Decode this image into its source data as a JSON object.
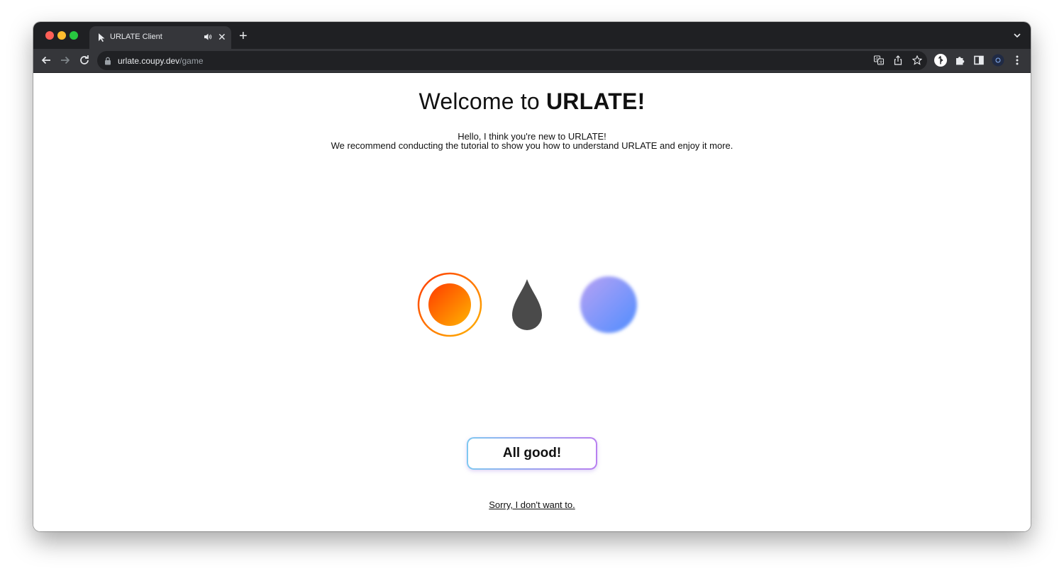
{
  "browser": {
    "tab": {
      "title": "URLATE Client"
    },
    "new_tab_label": "+",
    "tab_close_label": "✕",
    "address": {
      "host": "urlate.coupy.dev",
      "path": "/game"
    }
  },
  "page": {
    "heading_prefix": "Welcome to ",
    "heading_brand": "URLATE!",
    "intro_line1": "Hello, I think you're new to URLATE!",
    "intro_line2": "We recommend conducting the tutorial to show you how to understand URLATE and enjoy it more.",
    "confirm_button": "All good!",
    "decline_link": "Sorry, I don't want to."
  },
  "icons": {
    "favicon": "cursor-icon",
    "audio": "speaker-icon",
    "back": "arrow-left-icon",
    "forward": "arrow-right-icon",
    "reload": "reload-icon",
    "lock": "lock-icon",
    "translate": "translate-icon",
    "share": "share-icon",
    "bookmark": "star-icon",
    "extensions": "puzzle-icon",
    "side_panel": "side-panel-icon",
    "menu": "kebab-menu-icon"
  },
  "colors": {
    "note_gradient_start": "#ff4500",
    "note_gradient_end": "#ffb000",
    "bullet": "#4a4a4a",
    "orb_start": "#b3a3f5",
    "orb_end": "#5b8dff"
  }
}
